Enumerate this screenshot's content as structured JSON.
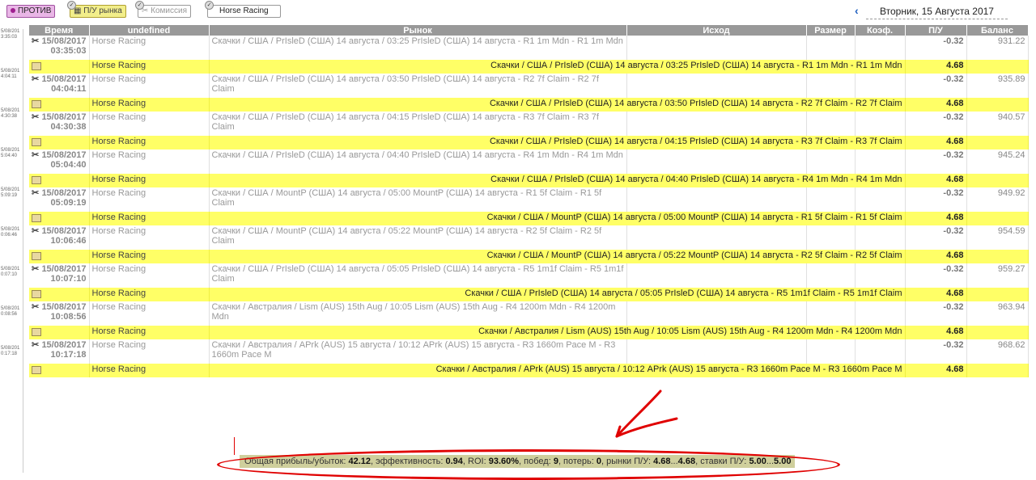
{
  "toolbar": {
    "against_label": "ПРОТИВ",
    "pl_label": "П/У рынка",
    "commission_label": "Комиссия",
    "sport_label": "Horse Racing",
    "date_label": "Вторник, 15 Августа 2017"
  },
  "columns": [
    "Время",
    "undefined",
    "Рынок",
    "Исход",
    "Размер",
    "Коэф.",
    "П/У",
    "Баланс"
  ],
  "side_labels": [
    [
      "5/08/201",
      "3:35:03"
    ],
    [
      "5/08/201",
      "4:04:11"
    ],
    [
      "5/08/201",
      "4:30:38"
    ],
    [
      "5/08/201",
      "5:04:40"
    ],
    [
      "5/08/201",
      "5:09:19"
    ],
    [
      "5/08/201",
      "0:06:46"
    ],
    [
      "5/08/201",
      "0:07:10"
    ],
    [
      "5/08/201",
      "0:08:56"
    ],
    [
      "5/08/201",
      "0:17:18"
    ]
  ],
  "rows": [
    {
      "date": "15/08/2017",
      "time": "03:35:03",
      "sport": "Horse Racing",
      "market": "Скачки / США / PrIsleD (США) 14 августа / 03:25 PrIsleD (США) 14 августа - R1 1m Mdn - R1 1m Mdn",
      "pl": "-0.32",
      "balance": "931.22",
      "mkt_pl": "4.68"
    },
    {
      "date": "15/08/2017",
      "time": "04:04:11",
      "sport": "Horse Racing",
      "market": "Скачки / США / PrIsleD (США) 14 августа / 03:50 PrIsleD (США) 14 августа - R2 7f Claim - R2 7f Claim",
      "pl": "-0.32",
      "balance": "935.89",
      "mkt_pl": "4.68"
    },
    {
      "date": "15/08/2017",
      "time": "04:30:38",
      "sport": "Horse Racing",
      "market": "Скачки / США / PrIsleD (США) 14 августа / 04:15 PrIsleD (США) 14 августа - R3 7f Claim - R3 7f Claim",
      "pl": "-0.32",
      "balance": "940.57",
      "mkt_pl": "4.68"
    },
    {
      "date": "15/08/2017",
      "time": "05:04:40",
      "sport": "Horse Racing",
      "market": "Скачки / США / PrIsleD (США) 14 августа / 04:40 PrIsleD (США) 14 августа - R4 1m Mdn - R4 1m Mdn",
      "pl": "-0.32",
      "balance": "945.24",
      "mkt_pl": "4.68"
    },
    {
      "date": "15/08/2017",
      "time": "05:09:19",
      "sport": "Horse Racing",
      "market": "Скачки / США / MountP (США) 14 августа / 05:00 MountP (США) 14 августа - R1 5f Claim - R1 5f Claim",
      "pl": "-0.32",
      "balance": "949.92",
      "mkt_pl": "4.68"
    },
    {
      "date": "15/08/2017",
      "time": "10:06:46",
      "sport": "Horse Racing",
      "market": "Скачки / США / MountP (США) 14 августа / 05:22 MountP (США) 14 августа - R2 5f Claim - R2 5f Claim",
      "pl": "-0.32",
      "balance": "954.59",
      "mkt_pl": "4.68"
    },
    {
      "date": "15/08/2017",
      "time": "10:07:10",
      "sport": "Horse Racing",
      "market": "Скачки / США / PrIsleD (США) 14 августа / 05:05 PrIsleD (США) 14 августа - R5 1m1f Claim - R5 1m1f Claim",
      "pl": "-0.32",
      "balance": "959.27",
      "mkt_pl": "4.68"
    },
    {
      "date": "15/08/2017",
      "time": "10:08:56",
      "sport": "Horse Racing",
      "market": "Скачки / Австралия / Lism (AUS) 15th Aug / 10:05 Lism (AUS) 15th Aug - R4 1200m Mdn - R4 1200m Mdn",
      "pl": "-0.32",
      "balance": "963.94",
      "mkt_pl": "4.68"
    },
    {
      "date": "15/08/2017",
      "time": "10:17:18",
      "sport": "Horse Racing",
      "market": "Скачки / Австралия / APrk (AUS) 15 августа / 10:12 APrk (AUS) 15 августа - R3 1660m Pace M - R3 1660m Pace M",
      "pl": "-0.32",
      "balance": "968.62",
      "mkt_pl": "4.68"
    }
  ],
  "summary": {
    "total_label": "Общая прибыль/убыток:",
    "total": "42.12",
    "eff_label": ", эффективность:",
    "eff": "0.94",
    "roi_label": ", ROI:",
    "roi": "93.60%",
    "wins_label": ", побед:",
    "wins": "9",
    "losses_label": ", потерь:",
    "losses": "0",
    "mkt_label": ", рынки П/У:",
    "mkt_min": "4.68",
    "mkt_sep": "...",
    "mkt_max": "4.68",
    "bets_label": ", ставки П/У:",
    "bets_min": "5.00",
    "bets_sep": "...",
    "bets_max": "5.00"
  },
  "colors": {
    "market_row": "#ffff66",
    "header": "#999999",
    "positive": "#1e9a1e",
    "annotation": "#e00000"
  }
}
